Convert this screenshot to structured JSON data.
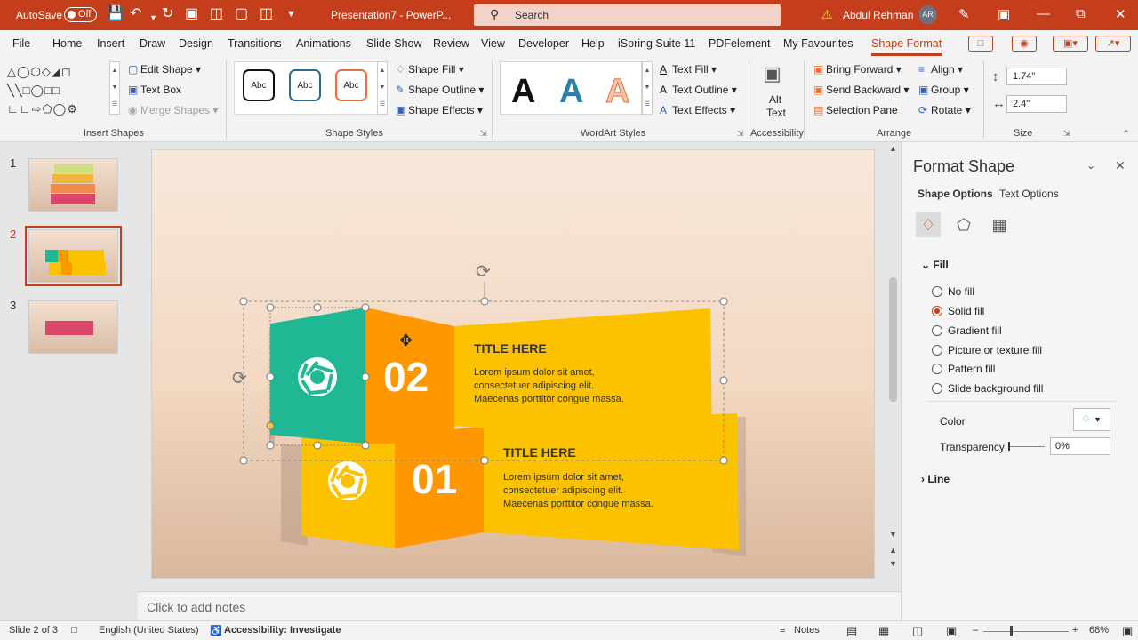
{
  "titlebar": {
    "autosave_label": "AutoSave",
    "autosave_state": "Off",
    "doc_title": "Presentation7 - PowerP...",
    "search_placeholder": "Search",
    "user_name": "Abdul Rehman",
    "user_initials": "AR"
  },
  "tabs": [
    "File",
    "Home",
    "Insert",
    "Draw",
    "Design",
    "Transitions",
    "Animations",
    "Slide Show",
    "Review",
    "View",
    "Developer",
    "Help",
    "iSpring Suite 11",
    "PDFelement",
    "My Favourites",
    "Shape Format"
  ],
  "ribbon": {
    "insert_shapes": {
      "label": "Insert Shapes",
      "edit_shape": "Edit Shape",
      "text_box": "Text Box",
      "merge_shapes": "Merge Shapes"
    },
    "shape_styles": {
      "label": "Shape Styles",
      "swatch_text": "Abc",
      "shape_fill": "Shape Fill",
      "shape_outline": "Shape Outline",
      "shape_effects": "Shape Effects"
    },
    "wordart_styles": {
      "label": "WordArt Styles",
      "sample": "A",
      "text_fill": "Text Fill",
      "text_outline": "Text Outline",
      "text_effects": "Text Effects"
    },
    "accessibility": {
      "label": "Accessibility",
      "alt_text_line1": "Alt",
      "alt_text_line2": "Text"
    },
    "arrange": {
      "label": "Arrange",
      "bring_forward": "Bring Forward",
      "send_backward": "Send Backward",
      "selection_pane": "Selection Pane",
      "align": "Align",
      "group": "Group",
      "rotate": "Rotate"
    },
    "size": {
      "label": "Size",
      "height": "1.74\"",
      "width": "2.4\""
    }
  },
  "slides": [
    {
      "number": "1"
    },
    {
      "number": "2"
    },
    {
      "number": "3"
    }
  ],
  "slide": {
    "step2": {
      "number": "02",
      "title": "TITLE HERE",
      "body": [
        "Lorem ipsum dolor sit amet,",
        "consectetuer adipiscing elit.",
        "Maecenas porttitor congue massa."
      ]
    },
    "step1": {
      "number": "01",
      "title": "TITLE HERE",
      "body": [
        "Lorem ipsum dolor sit amet,",
        "consectetuer adipiscing elit.",
        "Maecenas porttitor congue massa."
      ]
    }
  },
  "notes_placeholder": "Click to add notes",
  "format_pane": {
    "title": "Format Shape",
    "tab_shape": "Shape Options",
    "tab_text": "Text Options",
    "fill_section": "Fill",
    "fill_options": [
      "No fill",
      "Solid fill",
      "Gradient fill",
      "Picture or texture fill",
      "Pattern fill",
      "Slide background fill"
    ],
    "selected_fill": "Solid fill",
    "color_label": "Color",
    "transparency_label": "Transparency",
    "transparency_value": "0%",
    "line_section": "Line"
  },
  "status": {
    "slide_info": "Slide 2 of 3",
    "language": "English (United States)",
    "accessibility": "Accessibility: Investigate",
    "notes": "Notes",
    "zoom": "68%"
  },
  "colors": {
    "accent": "#c43e1c",
    "teal": "#20b894",
    "orange": "#ff9800",
    "yellow": "#fcc200"
  }
}
